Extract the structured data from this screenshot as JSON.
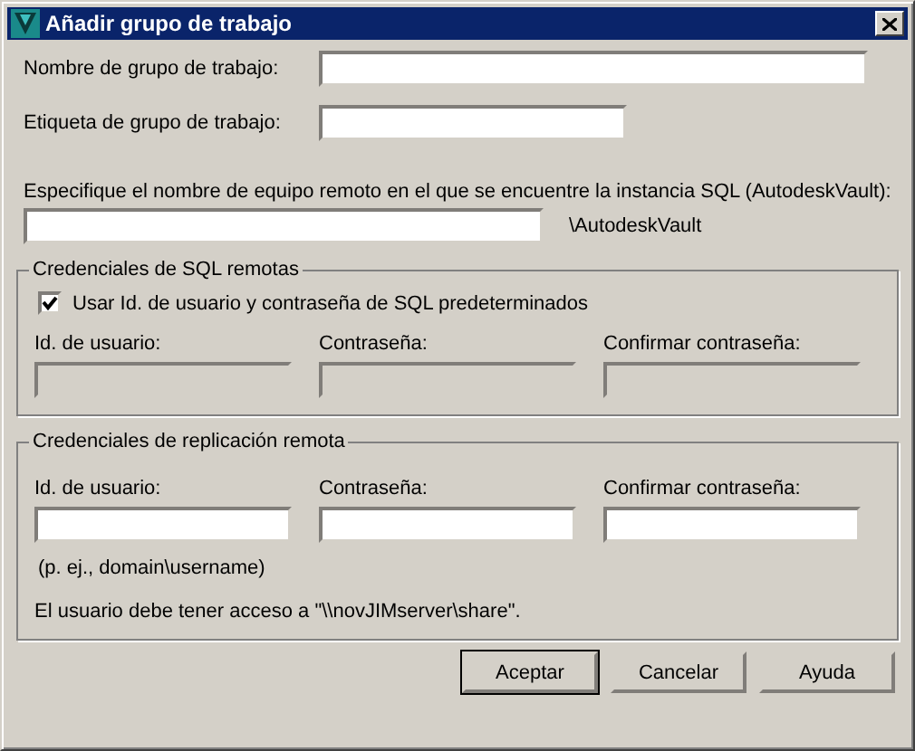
{
  "window": {
    "title": "Añadir grupo de trabajo"
  },
  "fields": [
    {
      "label": "Nombre de grupo de trabajo:",
      "kind": "wide"
    },
    {
      "label": "Etiqueta de grupo de trabajo:",
      "kind": "short"
    }
  ],
  "server": {
    "label": "Especifique el nombre de equipo remoto en el que se encuentre la instancia SQL (AutodeskVault):",
    "suffix": "\\AutodeskVault"
  },
  "sql_group": {
    "title": "Credenciales de SQL remotas",
    "checkbox": {
      "label": "Usar Id. de usuario y contraseña de SQL predeterminados",
      "checked": true
    },
    "fields": [
      {
        "label": "Id. de usuario:",
        "disabled": true
      },
      {
        "label": "Contraseña:",
        "disabled": true
      },
      {
        "label": "Confirmar contraseña:",
        "disabled": true
      }
    ]
  },
  "replication_group": {
    "title": "Credenciales de replicación remota",
    "fields": [
      {
        "label": "Id. de usuario:",
        "disabled": false
      },
      {
        "label": "Contraseña:",
        "disabled": false
      },
      {
        "label": "Confirmar contraseña:",
        "disabled": false
      }
    ],
    "hint": "(p. ej., domain\\username)",
    "note": "El usuario debe tener acceso a \"\\\\novJIMserver\\share\"."
  },
  "buttons": [
    {
      "label": "Aceptar",
      "default": true
    },
    {
      "label": "Cancelar",
      "default": false
    },
    {
      "label": "Ayuda",
      "default": false
    }
  ]
}
